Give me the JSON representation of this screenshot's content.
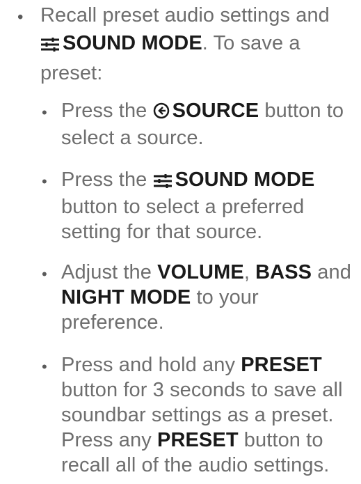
{
  "main_item": {
    "text_before": "Recall preset audio settings and",
    "strong": "SOUND MODE",
    "text_after": ". To save a preset:",
    "icon": "sound-mode-icon"
  },
  "sub_items": [
    {
      "before": "Press the ",
      "strong": "SOURCE",
      "after": " button to select a source.",
      "icon": "source-icon"
    },
    {
      "before": "Press the ",
      "strong": "SOUND MODE",
      "after": " button to select a preferred setting for that source.",
      "icon": "sound-mode-icon"
    },
    {
      "before": "Adjust the ",
      "strong_1": "VOLUME",
      "middle_1": ", ",
      "strong_2": "BASS",
      "middle_2": " and ",
      "strong_3": "NIGHT MODE",
      "after": " to your preference."
    },
    {
      "before": "Press and hold any ",
      "strong_1": "PRESET",
      "middle_1": " button for 3 seconds to save all soundbar settings as a preset. Press any ",
      "strong_2": "PRESET",
      "after": " button to recall all of the audio settings."
    }
  ],
  "colors": {
    "body_text": "#6e6e6e",
    "strong_text": "#1a1a1a",
    "bullet": "#5a5a5a"
  }
}
